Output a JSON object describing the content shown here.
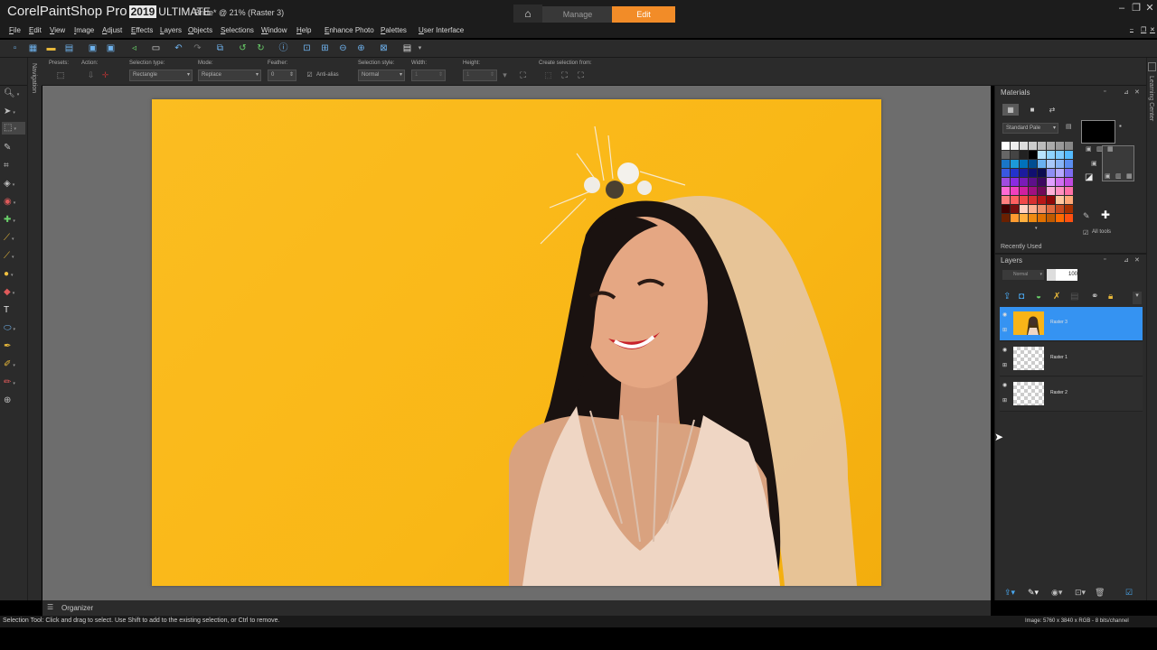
{
  "app": {
    "brand_corel": "Corel",
    "brand_name": "PaintShop Pro",
    "brand_year": "2019",
    "brand_edition": "ULTIMATE",
    "doc_title": "Bride* @ 21% (Raster 3)"
  },
  "workspace_tabs": {
    "manage": "Manage",
    "edit": "Edit"
  },
  "window_controls": {
    "minimize": "–",
    "restore": "❐",
    "close": "✕"
  },
  "menu": [
    "File",
    "Edit",
    "View",
    "Image",
    "Adjust",
    "Effects",
    "Layers",
    "Objects",
    "Selections",
    "Window",
    "Help",
    "Enhance Photo",
    "Palettes",
    "User Interface"
  ],
  "tool_options": {
    "presets_label": "Presets:",
    "action_label": "Action:",
    "selection_type_label": "Selection type:",
    "selection_type_value": "Rectangle",
    "mode_label": "Mode:",
    "mode_value": "Replace",
    "feather_label": "Feather:",
    "feather_value": "0",
    "antialias_label": "Anti-alias",
    "selection_style_label": "Selection style:",
    "selection_style_value": "Normal",
    "width_label": "Width:",
    "width_value": "1",
    "height_label": "Height:",
    "height_value": "1",
    "create_selection_label": "Create selection from:"
  },
  "side_tabs": {
    "navigation": "Navigation",
    "learning_center": "Learning Center"
  },
  "materials": {
    "title": "Materials",
    "palette_select": "Standard Pale",
    "recently_used": "Recently Used",
    "all_tools": "All tools",
    "fg_color": "#000000",
    "bg_color": "#ffffff",
    "swatch_rows": [
      [
        "#ffffff",
        "#eeeeee",
        "#dddddd",
        "#cccccc",
        "#bbbbbb",
        "#aaaaaa",
        "#999999",
        "#888888"
      ],
      [
        "#666666",
        "#444444",
        "#222222",
        "#000000",
        "#b7e4ff",
        "#8fd4ff",
        "#7ecbff",
        "#54baff"
      ],
      [
        "#1a76c8",
        "#1c9ad8",
        "#0072bc",
        "#004e92",
        "#6ab1f0",
        "#a8c8f8",
        "#88b5f5",
        "#5a8df0"
      ],
      [
        "#3a58e0",
        "#2233cc",
        "#1b1b9e",
        "#101070",
        "#0c0c50",
        "#8e8ef5",
        "#b5a8ff",
        "#7c6cf0"
      ],
      [
        "#a04ce0",
        "#8a2be2",
        "#7a1bb8",
        "#5d108a",
        "#3d0860",
        "#e0a0ff",
        "#d070f0",
        "#c04ae0"
      ],
      [
        "#ff6ad5",
        "#f040c0",
        "#d020a0",
        "#a01080",
        "#700a58",
        "#ffb0d8",
        "#ff90c0",
        "#ff70a8"
      ],
      [
        "#ff8080",
        "#ff6060",
        "#f04848",
        "#d83030",
        "#b81818",
        "#900808",
        "#ffc8a0",
        "#ffa878"
      ],
      [
        "#400000",
        "#7a1010",
        "#ffd0c0",
        "#ffb090",
        "#f0906a",
        "#e06a40",
        "#c84a20",
        "#a83000"
      ],
      [
        "#6a2000",
        "#ff9a30",
        "#ffb040",
        "#f08a10",
        "#e07000",
        "#c05a00",
        "#ff6a00",
        "#ff5010"
      ]
    ]
  },
  "layers": {
    "title": "Layers",
    "blend_mode": "Normal",
    "opacity": "100",
    "items": [
      {
        "name": "Raster 3",
        "selected": true
      },
      {
        "name": "Raster 1",
        "selected": false
      },
      {
        "name": "Raster 2",
        "selected": false
      }
    ]
  },
  "organizer": {
    "label": "Organizer"
  },
  "status": {
    "left": "Selection Tool: Click and drag to select. Use Shift to add to the existing selection, or Ctrl to remove.",
    "right": "Image: 5760 x 3840 x RGB - 8 bits/channel"
  }
}
